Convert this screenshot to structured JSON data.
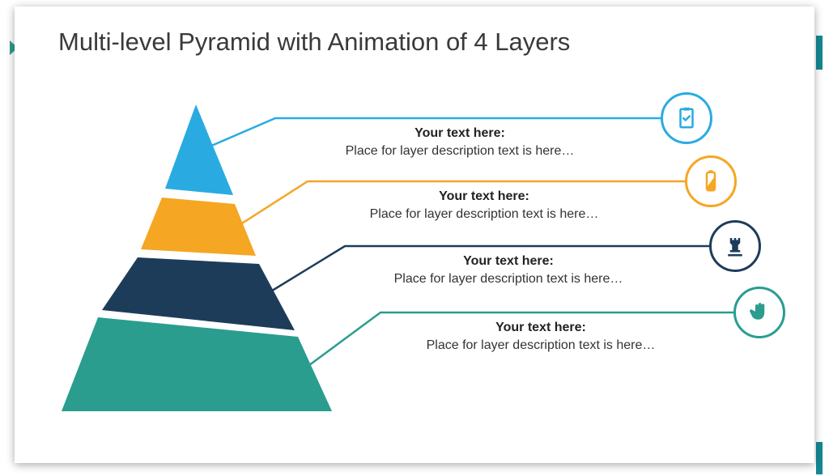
{
  "title": "Multi-level Pyramid with Animation of 4 Layers",
  "colors": {
    "layer1": "#29abe2",
    "layer2": "#f5a623",
    "layer3": "#1d3c5a",
    "layer4": "#2a9d8f"
  },
  "layers": [
    {
      "header": "Your text here:",
      "desc": "Place for layer description text is here…",
      "icon": "clipboard-check-icon"
    },
    {
      "header": "Your text here:",
      "desc": "Place for layer description text is here…",
      "icon": "battery-icon"
    },
    {
      "header": "Your text here:",
      "desc": "Place for layer description text is here…",
      "icon": "chess-rook-icon"
    },
    {
      "header": "Your text here:",
      "desc": "Place for layer description text is here…",
      "icon": "hand-icon"
    }
  ]
}
